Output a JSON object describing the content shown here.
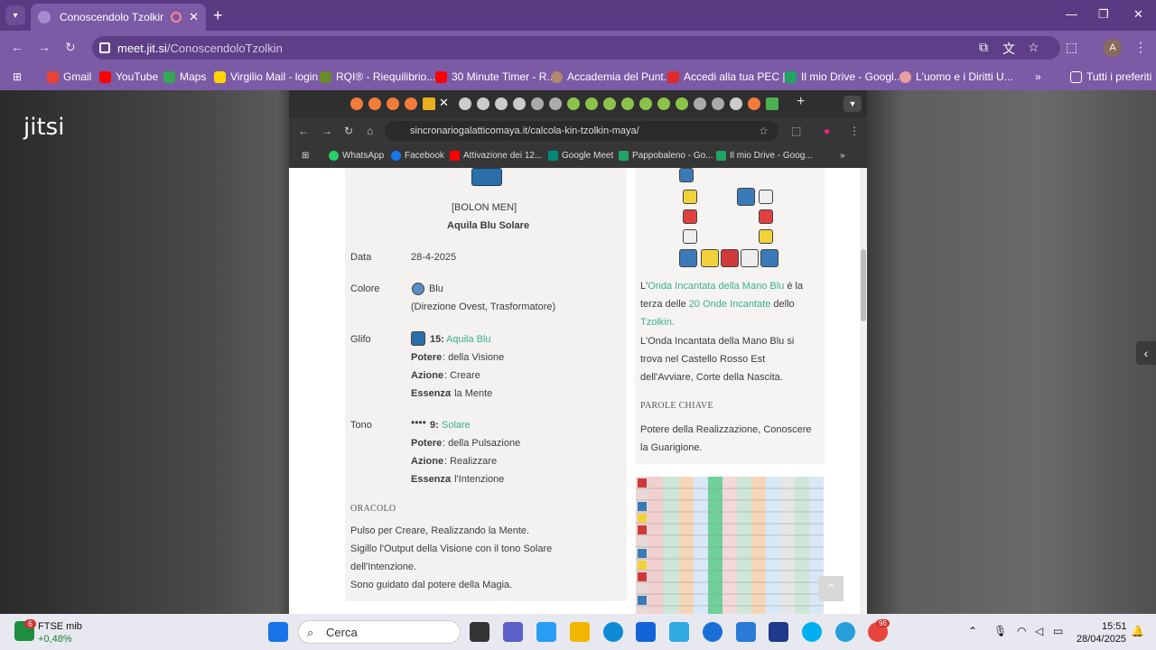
{
  "tab": {
    "title": "Conoscendolo Tzolkin | Jitsi"
  },
  "omnibox": {
    "host": "meet.jit.si",
    "path": "/ConoscendoloTzolkin"
  },
  "bookmarks": [
    "Gmail",
    "YouTube",
    "Maps",
    "Virgilio Mail - login",
    "RQI® - Riequilibrio...",
    "30 Minute Timer - R...",
    "Accademia del Punt...",
    "Accedi alla tua PEC |...",
    "Il mio Drive - Googl...",
    "L'uomo e i Diritti U..."
  ],
  "bookmarks_all": "Tutti i preferiti",
  "profile_initial": "A",
  "jitsi": {
    "logo": "jitsi"
  },
  "inner": {
    "url": "sincronariogalatticomaya.it/calcola-kin-tzolkin-maya/",
    "bookmarks": [
      "WhatsApp",
      "Facebook",
      "Attivazione dei 12...",
      "Google Meet",
      "Pappobaleno - Go...",
      "Il mio Drive - Goog..."
    ]
  },
  "kin": {
    "name_maya": "[BOLON MEN]",
    "name": "Aquila Blu Solare",
    "data_label": "Data",
    "data_value": "28-4-2025",
    "colore_label": "Colore",
    "colore_value": "Blu",
    "colore_desc": "(Direzione Ovest, Trasformatore)",
    "glifo_label": "Glifo",
    "glifo_num": "15:",
    "glifo_name": "Aquila Blu",
    "glifo_potere_k": "Potere",
    "glifo_potere_v": ": della Visione",
    "glifo_azione_k": "Azione",
    "glifo_azione_v": ": Creare",
    "glifo_essenza_k": "Essenza",
    "glifo_essenza_v": ": la Mente",
    "tono_label": "Tono",
    "tono_num": "9:",
    "tono_name": "Solare",
    "tono_potere_k": "Potere",
    "tono_potere_v": ": della Pulsazione",
    "tono_azione_k": "Azione",
    "tono_azione_v": ": Realizzare",
    "tono_essenza_k": "Essenza",
    "tono_essenza_v": ": l'Intenzione",
    "oracolo_label": "ORACOLO",
    "oracolo_lines": [
      "Pulso per Creare, Realizzando la Mente.",
      "Sigillo l'Output della Visione con il tono Solare",
      "dell'Intenzione.",
      "Sono guidato dal potere della Magia."
    ]
  },
  "onda": {
    "l1a": "L'",
    "l1b": "Onda Incantata della Mano Blu",
    "l1c": " è la",
    "l2a": "terza delle ",
    "l2b": "20 Onde Incantate",
    "l2c": " dello",
    "l3": "Tzolkin.",
    "l4": "L'Onda Incantata della Mano Blu si",
    "l5": "trova nel Castello Rosso Est",
    "l6": "dell'Avviare, Corte della Nascita.",
    "parole_label": "PAROLE CHIAVE",
    "parole_1": "Potere della Realizzazione, Conoscere",
    "parole_2": "la Guarigione."
  },
  "taskbar": {
    "stock_name": "FTSE mib",
    "stock_change": "+0,48%",
    "stock_badge": "6",
    "search": "Cerca",
    "time": "15:51",
    "date": "28/04/2025",
    "chrome_badge": "96"
  },
  "colors": {
    "tabbar": "#5a3a82",
    "toolbar": "#7b5aa6",
    "green_link": "#3bb08f"
  }
}
